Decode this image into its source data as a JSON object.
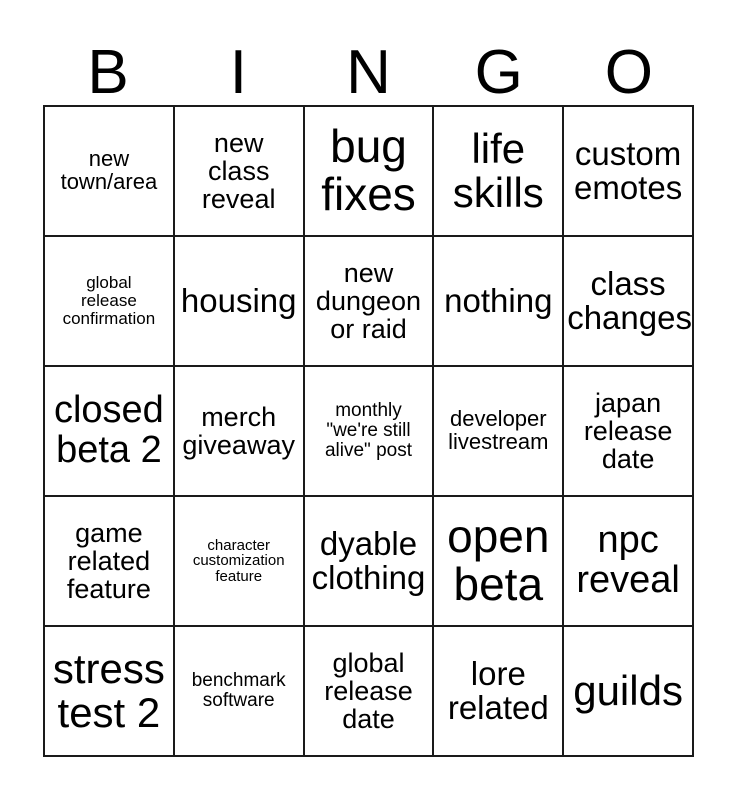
{
  "card": {
    "title": "BINGO",
    "header_letters": [
      "B",
      "I",
      "N",
      "G",
      "O"
    ],
    "grid_size": "5x5",
    "colors": {
      "background": "#ffffff",
      "text": "#000000",
      "border": "#1a1a1a"
    },
    "rows": [
      [
        {
          "text": "new\ntown/area",
          "size": "fs-xs"
        },
        {
          "text": "new\nclass\nreveal",
          "size": "fs-sm"
        },
        {
          "text": "bug\nfixes",
          "size": "fs-xxl"
        },
        {
          "text": "life\nskills",
          "size": "fs-xl"
        },
        {
          "text": "custom\nemotes",
          "size": "fs-md"
        }
      ],
      [
        {
          "text": "global\nrelease\nconfirmation",
          "size": "fs-3xs"
        },
        {
          "text": "housing",
          "size": "fs-md"
        },
        {
          "text": "new\ndungeon\nor raid",
          "size": "fs-sm"
        },
        {
          "text": "nothing",
          "size": "fs-md"
        },
        {
          "text": "class\nchanges",
          "size": "fs-md"
        }
      ],
      [
        {
          "text": "closed\nbeta 2",
          "size": "fs-lg"
        },
        {
          "text": "merch\ngiveaway",
          "size": "fs-sm"
        },
        {
          "text": "monthly\n\"we're still\nalive\" post",
          "size": "fs-xxs"
        },
        {
          "text": "developer\nlivestream",
          "size": "fs-xs"
        },
        {
          "text": "japan\nrelease\ndate",
          "size": "fs-sm"
        }
      ],
      [
        {
          "text": "game\nrelated\nfeature",
          "size": "fs-sm"
        },
        {
          "text": "character\ncustomization\nfeature",
          "size": "fs-4xs"
        },
        {
          "text": "dyable\nclothing",
          "size": "fs-md"
        },
        {
          "text": "open\nbeta",
          "size": "fs-xxl"
        },
        {
          "text": "npc\nreveal",
          "size": "fs-lg"
        }
      ],
      [
        {
          "text": "stress\ntest 2",
          "size": "fs-xl"
        },
        {
          "text": "benchmark\nsoftware",
          "size": "fs-xxs"
        },
        {
          "text": "global\nrelease\ndate",
          "size": "fs-sm"
        },
        {
          "text": "lore\nrelated",
          "size": "fs-md"
        },
        {
          "text": "guilds",
          "size": "fs-xl"
        }
      ]
    ]
  }
}
